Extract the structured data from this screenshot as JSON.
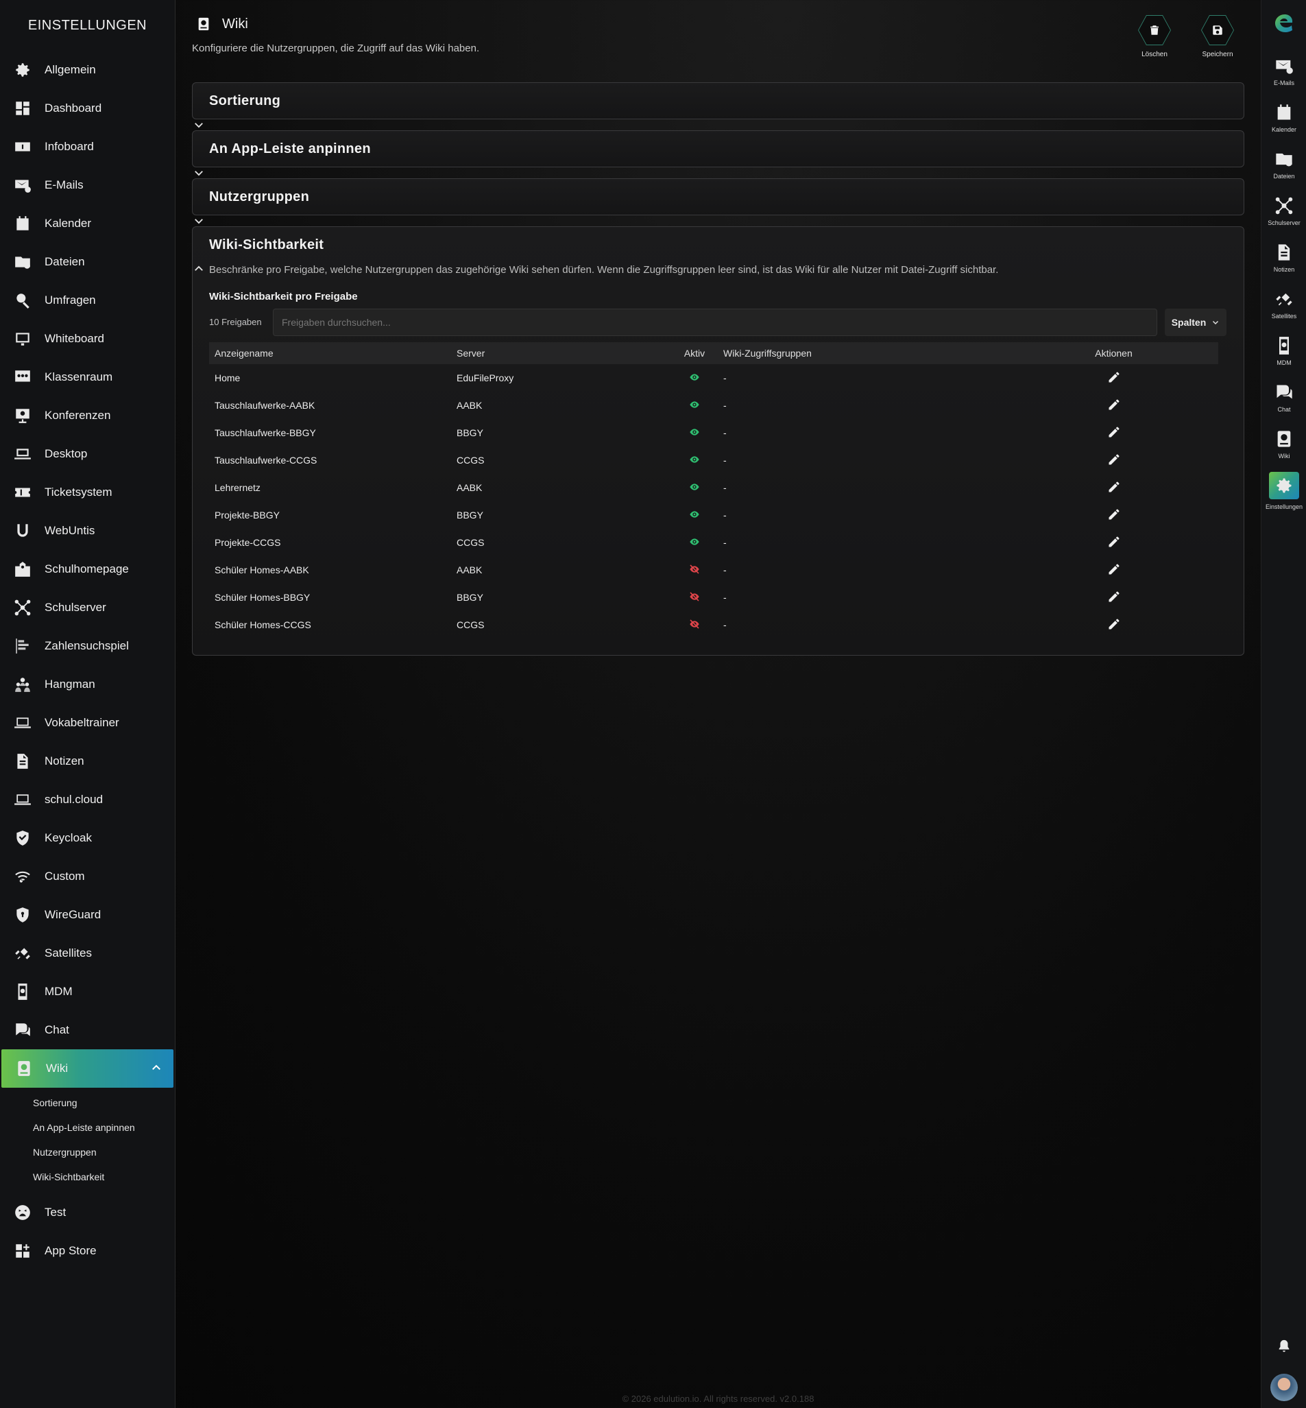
{
  "sidebar": {
    "title": "EINSTELLUNGEN",
    "items": [
      {
        "label": "Allgemein",
        "icon": "gear-icon"
      },
      {
        "label": "Dashboard",
        "icon": "dashboard-icon"
      },
      {
        "label": "Infoboard",
        "icon": "infoboard-icon"
      },
      {
        "label": "E-Mails",
        "icon": "mail-icon"
      },
      {
        "label": "Kalender",
        "icon": "calendar-icon"
      },
      {
        "label": "Dateien",
        "icon": "folder-icon"
      },
      {
        "label": "Umfragen",
        "icon": "survey-icon"
      },
      {
        "label": "Whiteboard",
        "icon": "whiteboard-icon"
      },
      {
        "label": "Klassenraum",
        "icon": "classroom-icon"
      },
      {
        "label": "Konferenzen",
        "icon": "conference-icon"
      },
      {
        "label": "Desktop",
        "icon": "laptop-icon"
      },
      {
        "label": "Ticketsystem",
        "icon": "ticket-icon"
      },
      {
        "label": "WebUntis",
        "icon": "webuntis-icon"
      },
      {
        "label": "Schulhomepage",
        "icon": "school-icon"
      },
      {
        "label": "Schulserver",
        "icon": "network-icon"
      },
      {
        "label": "Zahlensuchspiel",
        "icon": "chart-bars-icon"
      },
      {
        "label": "Hangman",
        "icon": "people-icon"
      },
      {
        "label": "Vokabeltrainer",
        "icon": "laptop-outline-icon"
      },
      {
        "label": "Notizen",
        "icon": "document-icon"
      },
      {
        "label": "schul.cloud",
        "icon": "laptop-outline-icon"
      },
      {
        "label": "Keycloak",
        "icon": "shield-check-icon"
      },
      {
        "label": "Custom",
        "icon": "wifi-icon"
      },
      {
        "label": "WireGuard",
        "icon": "shield-lock-icon"
      },
      {
        "label": "Satellites",
        "icon": "satellite-icon"
      },
      {
        "label": "MDM",
        "icon": "phone-gear-icon"
      },
      {
        "label": "Chat",
        "icon": "chat-icon"
      },
      {
        "label": "Wiki",
        "icon": "wiki-icon"
      }
    ],
    "sub_items": [
      "Sortierung",
      "An App-Leiste anpinnen",
      "Nutzergruppen",
      "Wiki-Sichtbarkeit"
    ],
    "after_items": [
      {
        "label": "Test",
        "icon": "sad-face-icon"
      },
      {
        "label": "App Store",
        "icon": "apps-plus-icon"
      }
    ]
  },
  "header": {
    "title": "Wiki",
    "subtitle": "Konfiguriere die Nutzergruppen, die Zugriff auf das Wiki haben.",
    "delete_label": "Löschen",
    "save_label": "Speichern"
  },
  "panels": {
    "sortierung": "Sortierung",
    "pin": "An App-Leiste anpinnen",
    "groups": "Nutzergruppen",
    "visibility": "Wiki-Sichtbarkeit"
  },
  "visibility": {
    "description": "Beschränke pro Freigabe, welche Nutzergruppen das zugehörige Wiki sehen dürfen. Wenn die Zugriffsgruppen leer sind, ist das Wiki für alle Nutzer mit Datei-Zugriff sichtbar.",
    "section_label": "Wiki-Sichtbarkeit pro Freigabe",
    "count": "10 Freigaben",
    "search_placeholder": "Freigaben durchsuchen...",
    "columns_button": "Spalten",
    "columns": [
      "Anzeigename",
      "Server",
      "Aktiv",
      "Wiki-Zugriffsgruppen",
      "Aktionen"
    ],
    "rows": [
      {
        "name": "Home",
        "server": "EduFileProxy",
        "active": true,
        "groups": "-"
      },
      {
        "name": "Tauschlaufwerke-AABK",
        "server": "AABK",
        "active": true,
        "groups": "-"
      },
      {
        "name": "Tauschlaufwerke-BBGY",
        "server": "BBGY",
        "active": true,
        "groups": "-"
      },
      {
        "name": "Tauschlaufwerke-CCGS",
        "server": "CCGS",
        "active": true,
        "groups": "-"
      },
      {
        "name": "Lehrernetz",
        "server": "AABK",
        "active": true,
        "groups": "-"
      },
      {
        "name": "Projekte-BBGY",
        "server": "BBGY",
        "active": true,
        "groups": "-"
      },
      {
        "name": "Projekte-CCGS",
        "server": "CCGS",
        "active": true,
        "groups": "-"
      },
      {
        "name": "Schüler Homes-AABK",
        "server": "AABK",
        "active": false,
        "groups": "-"
      },
      {
        "name": "Schüler Homes-BBGY",
        "server": "BBGY",
        "active": false,
        "groups": "-"
      },
      {
        "name": "Schüler Homes-CCGS",
        "server": "CCGS",
        "active": false,
        "groups": "-"
      }
    ]
  },
  "rail": {
    "items": [
      {
        "label": "E-Mails",
        "icon": "mail-icon"
      },
      {
        "label": "Kalender",
        "icon": "calendar-icon"
      },
      {
        "label": "Dateien",
        "icon": "folder-icon"
      },
      {
        "label": "Schulserver",
        "icon": "network-icon"
      },
      {
        "label": "Notizen",
        "icon": "document-icon"
      },
      {
        "label": "Satellites",
        "icon": "satellite-icon"
      },
      {
        "label": "MDM",
        "icon": "phone-gear-icon"
      },
      {
        "label": "Chat",
        "icon": "chat-icon"
      },
      {
        "label": "Wiki",
        "icon": "wiki-icon"
      },
      {
        "label": "Einstellungen",
        "icon": "gear-icon"
      }
    ]
  },
  "footer": "© 2026 edulution.io. All rights reserved. v2.0.188",
  "colors": {
    "accent_green": "#6cc24a",
    "accent_teal": "#2e9d8a",
    "accent_blue": "#1d86b9",
    "active_eye": "#2fbf71",
    "inactive_eye": "#e0454a"
  }
}
